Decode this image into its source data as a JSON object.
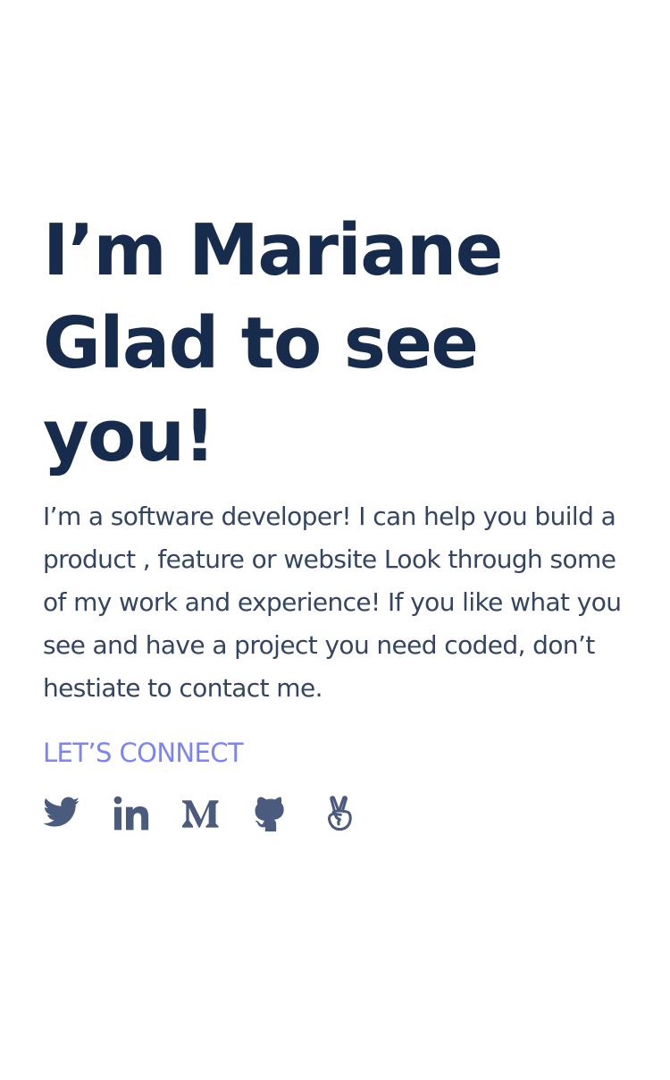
{
  "hero": {
    "headline_lines": [
      "I’m Mariane",
      "Glad to see",
      "you!"
    ],
    "intro": "I’m a software developer! I can help you build a product , feature or website Look through some of my work and experience! If you like what you see and have a project you need coded, don’t hestiate to contact me.",
    "connect_label": "LET’S CONNECT"
  },
  "socials": [
    {
      "name": "twitter",
      "icon": "twitter-icon"
    },
    {
      "name": "linkedin",
      "icon": "linkedin-icon"
    },
    {
      "name": "medium",
      "icon": "medium-icon"
    },
    {
      "name": "github",
      "icon": "github-icon"
    },
    {
      "name": "angellist",
      "icon": "angellist-icon"
    }
  ],
  "colors": {
    "headline": "#172b4d",
    "body_text": "#344563",
    "accent": "#7b83f5",
    "icon": "#4a5b7d"
  }
}
